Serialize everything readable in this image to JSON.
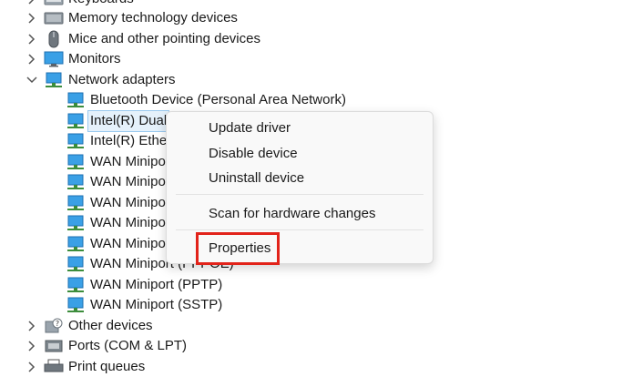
{
  "tree": {
    "keyboards": "Keyboards",
    "memory_tech": "Memory technology devices",
    "mice": "Mice and other pointing devices",
    "monitors": "Monitors",
    "network_adapters": "Network adapters",
    "adapters": [
      "Bluetooth Device (Personal Area Network)",
      "Intel(R) Dual",
      "Intel(R) Ether",
      "WAN Minipo",
      "WAN Minipo",
      "WAN Minipo",
      "WAN Minipo",
      "WAN Minipo",
      "WAN Miniport (PPPOE)",
      "WAN Miniport (PPTP)",
      "WAN Miniport (SSTP)"
    ],
    "other_devices": "Other devices",
    "ports": "Ports (COM & LPT)",
    "print_queues": "Print queues"
  },
  "context_menu": {
    "update_driver": "Update driver",
    "disable_device": "Disable device",
    "uninstall_device": "Uninstall device",
    "scan_hardware": "Scan for hardware changes",
    "properties": "Properties"
  },
  "colors": {
    "highlight_border": "#e2231a",
    "selection_bg": "#e5f1fb"
  }
}
